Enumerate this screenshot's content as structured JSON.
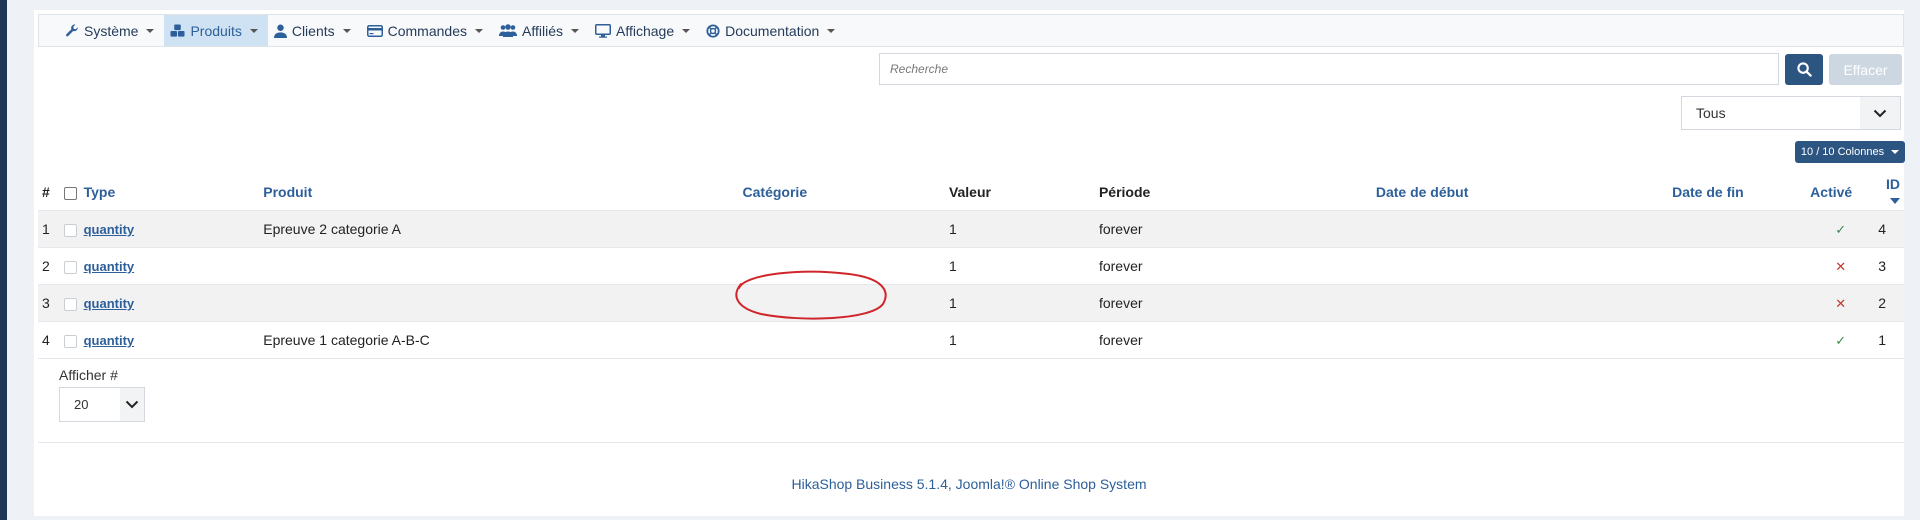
{
  "menu": [
    {
      "icon": "wrench-icon",
      "label": "Système",
      "active": false
    },
    {
      "icon": "cubes-icon",
      "label": "Produits",
      "active": true
    },
    {
      "icon": "user-icon",
      "label": "Clients",
      "active": false
    },
    {
      "icon": "credit-card-icon",
      "label": "Commandes",
      "active": false
    },
    {
      "icon": "users-icon",
      "label": "Affiliés",
      "active": false
    },
    {
      "icon": "monitor-icon",
      "label": "Affichage",
      "active": false
    },
    {
      "icon": "lifebuoy-icon",
      "label": "Documentation",
      "active": false
    }
  ],
  "search": {
    "placeholder": "Recherche",
    "value": ""
  },
  "buttons": {
    "clear": "Effacer",
    "columns": "10 / 10 Colonnes"
  },
  "filter": {
    "status": "Tous"
  },
  "table": {
    "headers": {
      "num": "#",
      "type": "Type",
      "product": "Produit",
      "category": "Catégorie",
      "value": "Valeur",
      "period": "Période",
      "start": "Date de début",
      "end": "Date de fin",
      "active": "Activé",
      "id": "ID"
    },
    "rows": [
      {
        "num": "1",
        "type": "quantity",
        "product": "Epreuve 2 categorie A",
        "category": "",
        "value": "1",
        "period": "forever",
        "start": "",
        "end": "",
        "active": "✓",
        "id": "4"
      },
      {
        "num": "2",
        "type": "quantity",
        "product": "",
        "category": "",
        "value": "1",
        "period": "forever",
        "start": "",
        "end": "",
        "active": "✕",
        "id": "3"
      },
      {
        "num": "3",
        "type": "quantity",
        "product": "",
        "category": "",
        "value": "1",
        "period": "forever",
        "start": "",
        "end": "",
        "active": "✕",
        "id": "2"
      },
      {
        "num": "4",
        "type": "quantity",
        "product": "Epreuve 1 categorie A-B-C",
        "category": "",
        "value": "1",
        "period": "forever",
        "start": "",
        "end": "",
        "active": "✓",
        "id": "1"
      }
    ]
  },
  "pagination": {
    "label": "Afficher #",
    "value": "20"
  },
  "footer": {
    "text": "HikaShop Business 5.1.4, Joomla!® Online Shop System"
  },
  "colors": {
    "accent": "#2d5582",
    "link": "#2d5f9a",
    "active_tab": "#cfe2f3",
    "annotation": "#d0262b"
  }
}
